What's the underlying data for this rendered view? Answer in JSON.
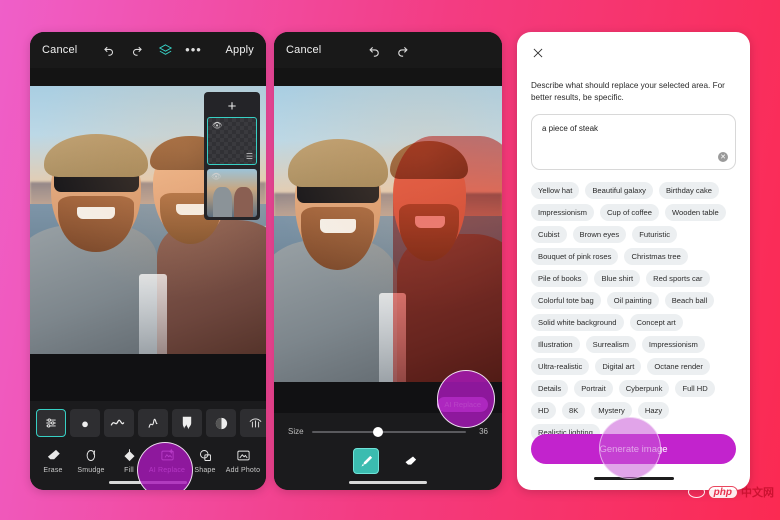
{
  "background": {
    "from": "#ef5fc9",
    "to": "#fb2a52"
  },
  "accent": {
    "teal": "#37d0c4",
    "purple": "#c223cd",
    "mask_red": "#ec2e26"
  },
  "phone1": {
    "topbar": {
      "cancel": "Cancel",
      "undo_icon": "undo-icon",
      "redo_icon": "redo-icon",
      "layers_icon": "layers-icon",
      "more_icon": "more-options-icon",
      "apply": "Apply"
    },
    "layers": {
      "add": "+",
      "selected_layer": "transparent-layer",
      "photo_layer": "photo-layer"
    },
    "brushes": [
      "brush-settings",
      "round-brush",
      "scribble-brush",
      "thin-brush",
      "drip-brush",
      "half-tone-brush",
      "fan-brush"
    ],
    "tools": [
      {
        "label": "Erase",
        "icon": "eraser-icon",
        "active": false
      },
      {
        "label": "Smudge",
        "icon": "smudge-icon",
        "active": false
      },
      {
        "label": "Fill",
        "icon": "fill-bucket-icon",
        "active": false
      },
      {
        "label": "AI Replace",
        "icon": "ai-replace-icon",
        "active": true
      },
      {
        "label": "Shape",
        "icon": "shape-icon",
        "active": false
      },
      {
        "label": "Add Photo",
        "icon": "add-photo-icon",
        "active": false
      }
    ]
  },
  "phone2": {
    "topbar": {
      "cancel": "Cancel",
      "undo_icon": "undo-icon",
      "redo_icon": "redo-icon"
    },
    "badge": "AI Replace",
    "size": {
      "label": "Size",
      "value": "36"
    },
    "tools": [
      {
        "icon": "brush-icon",
        "selected": true
      },
      {
        "icon": "eraser-icon",
        "selected": false
      }
    ]
  },
  "phone3": {
    "close_icon": "close-icon",
    "description": "Describe what should replace your selected area. For better results, be specific.",
    "prompt_value": "a piece of steak",
    "prompt_placeholder": "Describe what should replace your selected area",
    "clear_icon": "clear-input-icon",
    "chips": [
      "Yellow hat",
      "Beautiful galaxy",
      "Birthday cake",
      "Impressionism",
      "Cup of coffee",
      "Wooden table",
      "Cubist",
      "Brown eyes",
      "Futuristic",
      "Bouquet of pink roses",
      "Christmas tree",
      "Pile of books",
      "Blue shirt",
      "Red sports car",
      "Colorful tote bag",
      "Oil painting",
      "Beach ball",
      "Solid white background",
      "Concept art",
      "Illustration",
      "Surrealism",
      "Impressionism",
      "Ultra-realistic",
      "Digital art",
      "Octane render",
      "Details",
      "Portrait",
      "Cyberpunk",
      "Full HD",
      "HD",
      "8K",
      "Mystery",
      "Hazy",
      "Realistic lighting"
    ],
    "generate_button": "Generate image"
  },
  "watermark": {
    "pill": "php",
    "cn": "中文网"
  }
}
